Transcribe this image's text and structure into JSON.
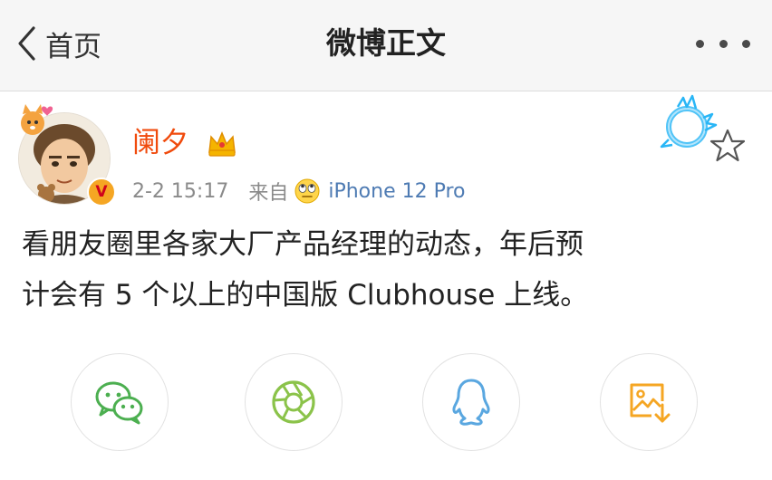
{
  "nav": {
    "back_label": "首页",
    "title": "微博正文",
    "more_icon": "more-dots-icon"
  },
  "post": {
    "user_name": "阑夕",
    "time": "2-2 15:17",
    "source_label": "来自",
    "device": "iPhone 12 Pro",
    "content_lines": [
      "看朋友圈里各家大厂产品经理的动态，年后预",
      "计会有 5 个以上的中国版 Clubhouse 上线。"
    ],
    "badges": [
      "verified-v-icon",
      "crown-icon",
      "fan-ring-icon"
    ],
    "follow_icon": "star-outline-icon"
  },
  "share": {
    "buttons": [
      {
        "name": "wechat",
        "icon": "wechat-icon"
      },
      {
        "name": "moments",
        "icon": "moments-icon"
      },
      {
        "name": "qq",
        "icon": "qq-icon"
      },
      {
        "name": "save-image",
        "icon": "save-image-icon"
      }
    ]
  },
  "colors": {
    "username": "#f04a0c",
    "device_link": "#4e7bb3",
    "wechat": "#4caf50",
    "moments": "#8bc34a",
    "qq": "#5aa7e0",
    "save_image": "#f5a623"
  }
}
